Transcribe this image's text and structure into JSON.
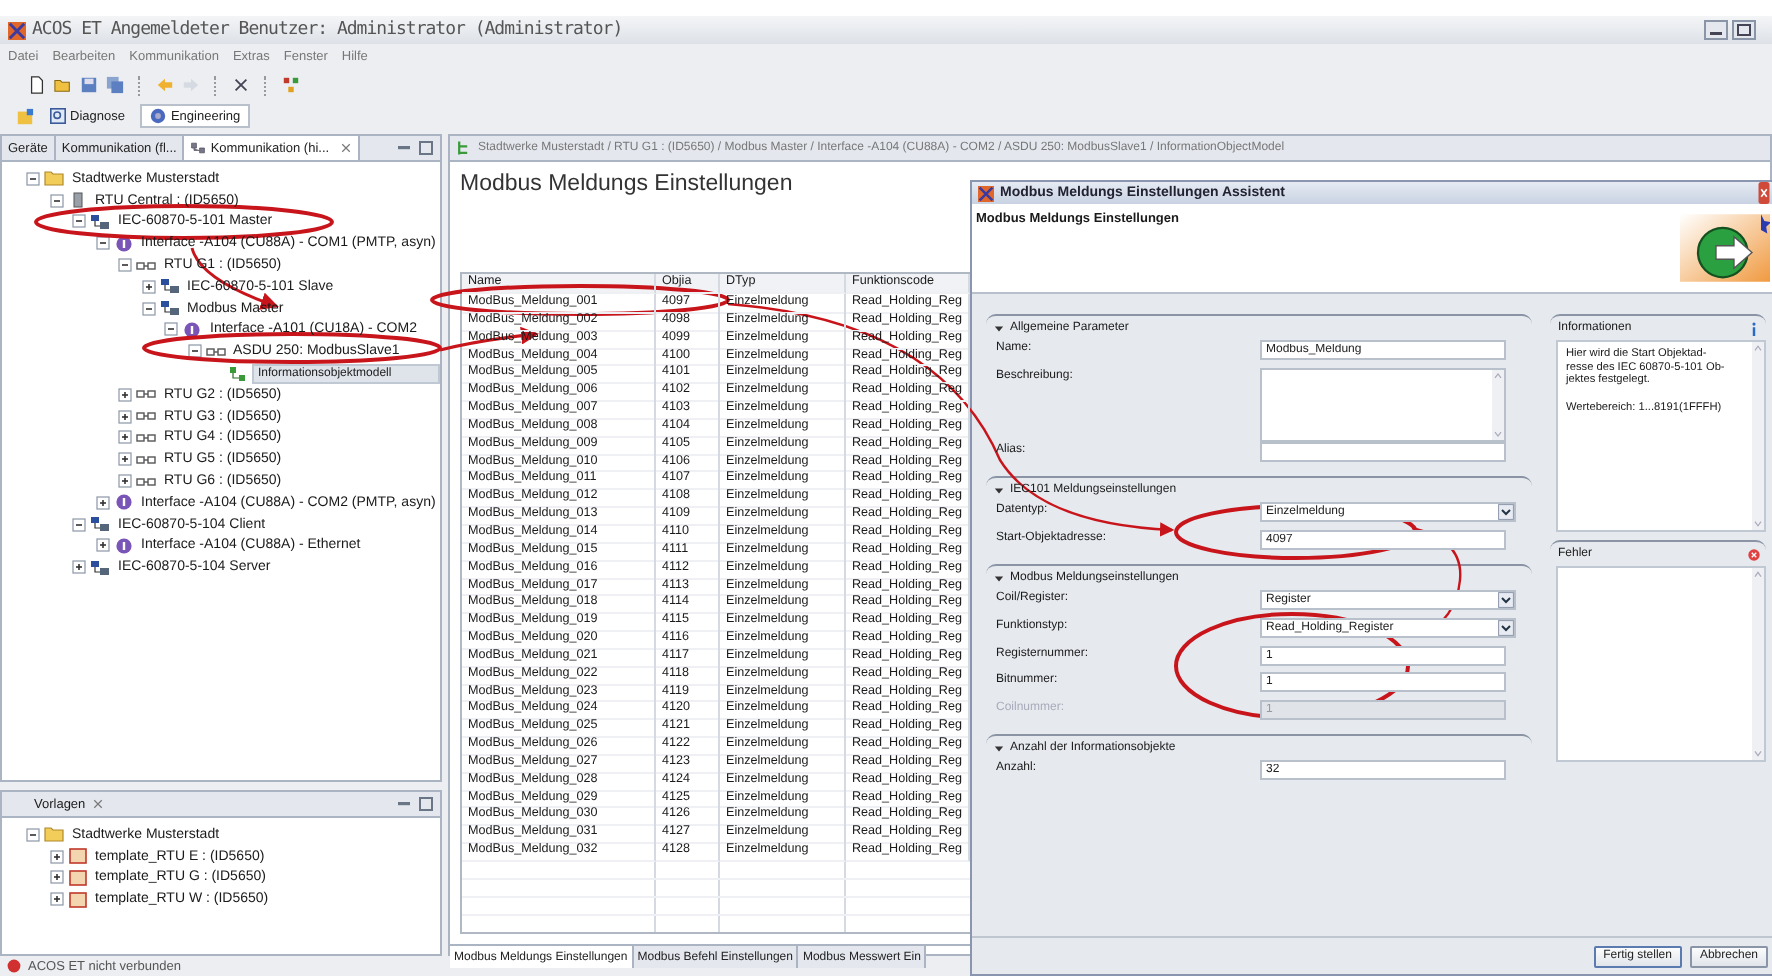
{
  "window": {
    "title": "ACOS ET  Angemeldeter Benutzer: Administrator (Administrator)"
  },
  "menu": [
    "Datei",
    "Bearbeiten",
    "Kommunikation",
    "Extras",
    "Fenster",
    "Hilfe"
  ],
  "perspectives": [
    {
      "label": "Diagnose",
      "selected": false
    },
    {
      "label": "Engineering",
      "selected": true
    }
  ],
  "left_panel": {
    "tabs": [
      {
        "label": "Geräte",
        "selected": false
      },
      {
        "label": "Kommunikation (fl...",
        "selected": false
      },
      {
        "label": "Kommunikation (hi...",
        "selected": true
      }
    ],
    "tree": [
      {
        "label": "Stadtwerke Musterstadt",
        "kind": "folder",
        "expanded": true,
        "selected": false,
        "children": [
          {
            "label": "RTU Central : (ID5650)",
            "kind": "device",
            "expanded": true,
            "selected": false,
            "children": [
              {
                "label": "IEC-60870-5-101 Master",
                "kind": "protocol",
                "expanded": true,
                "selected": false,
                "children": [
                  {
                    "label": "Interface -A104 (CU88A) - COM1 (PMTP, asyn)",
                    "kind": "interface",
                    "expanded": true,
                    "selected": false,
                    "children": [
                      {
                        "label": "RTU G1 : (ID5650)",
                        "kind": "rtu",
                        "expanded": true,
                        "selected": false,
                        "children": [
                          {
                            "label": "IEC-60870-5-101 Slave",
                            "kind": "protocol",
                            "expanded": false,
                            "selected": false
                          },
                          {
                            "label": "Modbus Master",
                            "kind": "protocol",
                            "expanded": true,
                            "selected": false,
                            "children": [
                              {
                                "label": "Interface -A101 (CU18A) - COM2",
                                "kind": "interface",
                                "expanded": true,
                                "selected": false,
                                "children": [
                                  {
                                    "label": "ASDU 250: ModbusSlave1",
                                    "kind": "rtu",
                                    "expanded": true,
                                    "selected": false,
                                    "children": [
                                      {
                                        "label": "Informationsobjektmodell",
                                        "kind": "object",
                                        "selected": true
                                      }
                                    ]
                                  }
                                ]
                              }
                            ]
                          }
                        ]
                      },
                      {
                        "label": "RTU G2 : (ID5650)",
                        "kind": "rtu",
                        "expanded": false,
                        "selected": false
                      },
                      {
                        "label": "RTU G3 : (ID5650)",
                        "kind": "rtu",
                        "expanded": false,
                        "selected": false
                      },
                      {
                        "label": "RTU G4 : (ID5650)",
                        "kind": "rtu",
                        "expanded": false,
                        "selected": false
                      },
                      {
                        "label": "RTU G5 : (ID5650)",
                        "kind": "rtu",
                        "expanded": false,
                        "selected": false
                      },
                      {
                        "label": "RTU G6 : (ID5650)",
                        "kind": "rtu",
                        "expanded": false,
                        "selected": false
                      }
                    ]
                  },
                  {
                    "label": "Interface -A104 (CU88A) - COM2 (PMTP, asyn)",
                    "kind": "interface",
                    "expanded": false,
                    "selected": false
                  }
                ]
              },
              {
                "label": "IEC-60870-5-104 Client",
                "kind": "protocol",
                "expanded": true,
                "selected": false,
                "children": [
                  {
                    "label": "Interface -A104 (CU88A) - Ethernet",
                    "kind": "interface",
                    "expanded": false,
                    "selected": false
                  }
                ]
              },
              {
                "label": "IEC-60870-5-104 Server",
                "kind": "protocol",
                "expanded": false,
                "selected": false
              }
            ]
          }
        ]
      }
    ]
  },
  "templates_panel": {
    "title": "Vorlagen",
    "tree": [
      {
        "label": "Stadtwerke Musterstadt",
        "kind": "folder",
        "expanded": true,
        "selected": false,
        "children": [
          {
            "label": "template_RTU E : (ID5650)",
            "kind": "template",
            "expanded": false,
            "selected": false
          },
          {
            "label": "template_RTU G : (ID5650)",
            "kind": "template",
            "expanded": false,
            "selected": false
          },
          {
            "label": "template_RTU W : (ID5650)",
            "kind": "template",
            "expanded": false,
            "selected": false
          }
        ]
      }
    ]
  },
  "editor": {
    "breadcrumb": "Stadtwerke Musterstadt / RTU G1 : (ID5650) / Modbus Master / Interface -A104 (CU88A) - COM2 / ASDU 250: ModbusSlave1 / InformationObjectModel",
    "heading": "Modbus Meldungs Einstellungen",
    "table": {
      "columns": [
        "Name",
        "Objia",
        "DTyp",
        "Funktionscode"
      ],
      "rows": [
        [
          "ModBus_Meldung_001",
          "4097",
          "Einzelmeldung",
          "Read_Holding_Reg"
        ],
        [
          "ModBus_Meldung_002",
          "4098",
          "Einzelmeldung",
          "Read_Holding_Reg"
        ],
        [
          "ModBus_Meldung_003",
          "4099",
          "Einzelmeldung",
          "Read_Holding_Reg"
        ],
        [
          "ModBus_Meldung_004",
          "4100",
          "Einzelmeldung",
          "Read_Holding_Reg"
        ],
        [
          "ModBus_Meldung_005",
          "4101",
          "Einzelmeldung",
          "Read_Holding_Reg"
        ],
        [
          "ModBus_Meldung_006",
          "4102",
          "Einzelmeldung",
          "Read_Holding_Reg"
        ],
        [
          "ModBus_Meldung_007",
          "4103",
          "Einzelmeldung",
          "Read_Holding_Reg"
        ],
        [
          "ModBus_Meldung_008",
          "4104",
          "Einzelmeldung",
          "Read_Holding_Reg"
        ],
        [
          "ModBus_Meldung_009",
          "4105",
          "Einzelmeldung",
          "Read_Holding_Reg"
        ],
        [
          "ModBus_Meldung_010",
          "4106",
          "Einzelmeldung",
          "Read_Holding_Reg"
        ],
        [
          "ModBus_Meldung_011",
          "4107",
          "Einzelmeldung",
          "Read_Holding_Reg"
        ],
        [
          "ModBus_Meldung_012",
          "4108",
          "Einzelmeldung",
          "Read_Holding_Reg"
        ],
        [
          "ModBus_Meldung_013",
          "4109",
          "Einzelmeldung",
          "Read_Holding_Reg"
        ],
        [
          "ModBus_Meldung_014",
          "4110",
          "Einzelmeldung",
          "Read_Holding_Reg"
        ],
        [
          "ModBus_Meldung_015",
          "4111",
          "Einzelmeldung",
          "Read_Holding_Reg"
        ],
        [
          "ModBus_Meldung_016",
          "4112",
          "Einzelmeldung",
          "Read_Holding_Reg"
        ],
        [
          "ModBus_Meldung_017",
          "4113",
          "Einzelmeldung",
          "Read_Holding_Reg"
        ],
        [
          "ModBus_Meldung_018",
          "4114",
          "Einzelmeldung",
          "Read_Holding_Reg"
        ],
        [
          "ModBus_Meldung_019",
          "4115",
          "Einzelmeldung",
          "Read_Holding_Reg"
        ],
        [
          "ModBus_Meldung_020",
          "4116",
          "Einzelmeldung",
          "Read_Holding_Reg"
        ],
        [
          "ModBus_Meldung_021",
          "4117",
          "Einzelmeldung",
          "Read_Holding_Reg"
        ],
        [
          "ModBus_Meldung_022",
          "4118",
          "Einzelmeldung",
          "Read_Holding_Reg"
        ],
        [
          "ModBus_Meldung_023",
          "4119",
          "Einzelmeldung",
          "Read_Holding_Reg"
        ],
        [
          "ModBus_Meldung_024",
          "4120",
          "Einzelmeldung",
          "Read_Holding_Reg"
        ],
        [
          "ModBus_Meldung_025",
          "4121",
          "Einzelmeldung",
          "Read_Holding_Reg"
        ],
        [
          "ModBus_Meldung_026",
          "4122",
          "Einzelmeldung",
          "Read_Holding_Reg"
        ],
        [
          "ModBus_Meldung_027",
          "4123",
          "Einzelmeldung",
          "Read_Holding_Reg"
        ],
        [
          "ModBus_Meldung_028",
          "4124",
          "Einzelmeldung",
          "Read_Holding_Reg"
        ],
        [
          "ModBus_Meldung_029",
          "4125",
          "Einzelmeldung",
          "Read_Holding_Reg"
        ],
        [
          "ModBus_Meldung_030",
          "4126",
          "Einzelmeldung",
          "Read_Holding_Reg"
        ],
        [
          "ModBus_Meldung_031",
          "4127",
          "Einzelmeldung",
          "Read_Holding_Reg"
        ],
        [
          "ModBus_Meldung_032",
          "4128",
          "Einzelmeldung",
          "Read_Holding_Reg"
        ]
      ]
    },
    "tabs": [
      {
        "label": "Modbus Meldungs Einstellungen",
        "selected": true
      },
      {
        "label": "Modbus Befehl Einstellungen",
        "selected": false
      },
      {
        "label": "Modbus Messwert Ein",
        "selected": false
      }
    ]
  },
  "dialog": {
    "title": "Modbus Meldungs Einstellungen Assistent",
    "heading": "Modbus Meldungs Einstellungen",
    "sections": [
      {
        "title": "Allgemeine Parameter",
        "fields": [
          {
            "label": "Name:",
            "kind": "text",
            "value": "Modbus_Meldung",
            "disabled": false
          },
          {
            "label": "Beschreibung:",
            "kind": "textarea",
            "disabled": false
          },
          {
            "label": "Alias:",
            "kind": "text",
            "disabled": false
          }
        ]
      },
      {
        "title": "IEC101 Meldungseinstellungen",
        "fields": [
          {
            "label": "Datentyp:",
            "kind": "select",
            "value": "Einzelmeldung",
            "disabled": false
          },
          {
            "label": "Start-Objektadresse:",
            "kind": "text",
            "value": "4097",
            "disabled": false
          }
        ]
      },
      {
        "title": "Modbus Meldungseinstellungen",
        "fields": [
          {
            "label": "Coil/Register:",
            "kind": "select",
            "value": "Register",
            "disabled": false
          },
          {
            "label": "Funktionstyp:",
            "kind": "select",
            "value": "Read_Holding_Register",
            "disabled": false
          },
          {
            "label": "Registernummer:",
            "kind": "text",
            "value": "1",
            "disabled": false
          },
          {
            "label": "Bitnummer:",
            "kind": "text",
            "value": "1",
            "disabled": false
          },
          {
            "label": "Coilnummer:",
            "kind": "text",
            "value": "1",
            "disabled": true
          }
        ]
      },
      {
        "title": "Anzahl der Informationsobjekte",
        "fields": [
          {
            "label": "Anzahl:",
            "kind": "text",
            "value": "32",
            "disabled": false
          }
        ]
      }
    ],
    "info": {
      "title": "Informationen",
      "lines": [
        "Hier wird die Start Objektad-",
        "resse des IEC 60870-5-101 Ob-",
        "jektes festgelegt."
      ],
      "range": "Wertebereich: 1...8191(1FFFH)"
    },
    "errors": {
      "title": "Fehler"
    },
    "buttons": [
      "Fertig stellen",
      "Abbrechen"
    ]
  },
  "status_bar": "ACOS ET nicht verbunden"
}
